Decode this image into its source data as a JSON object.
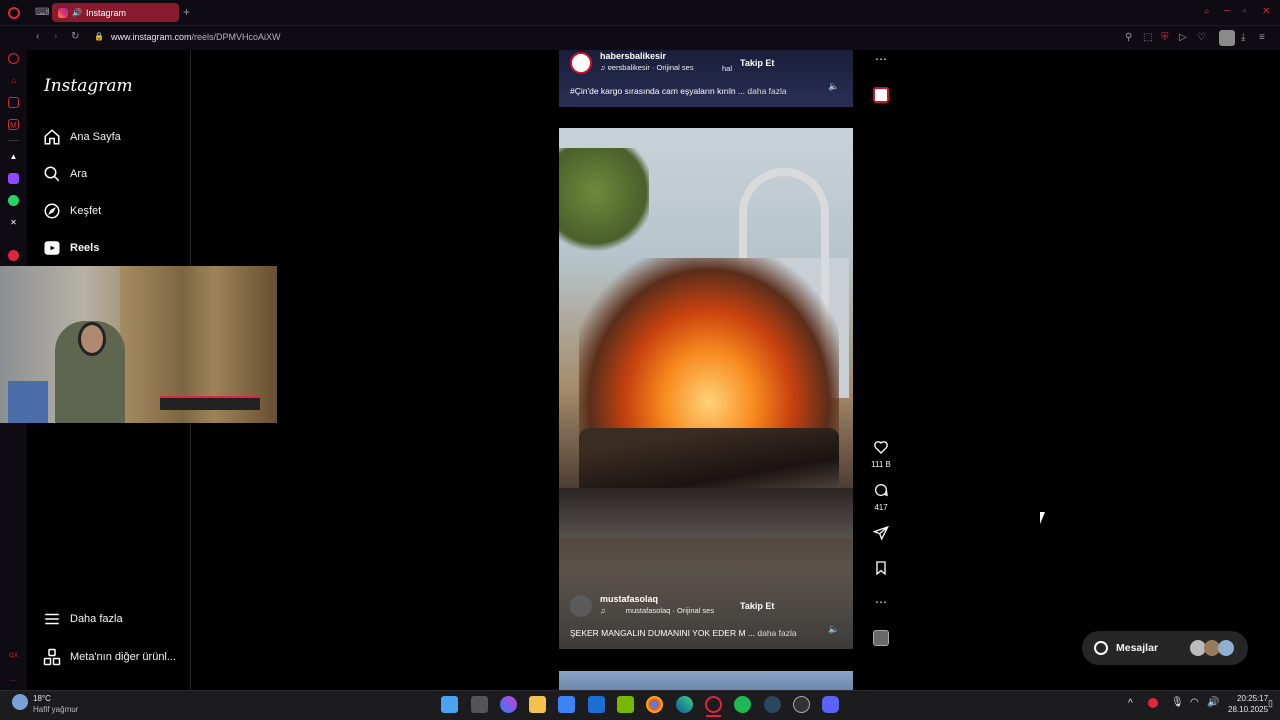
{
  "browser": {
    "tab_title": "Instagram",
    "url_host": "www.instagram.com",
    "url_path": "/reels/DPMVHcoAiXW"
  },
  "nav": {
    "logo": "Instagram",
    "items": [
      {
        "label": "Ana Sayfa",
        "icon": "home-icon"
      },
      {
        "label": "Ara",
        "icon": "search-icon"
      },
      {
        "label": "Keşfet",
        "icon": "compass-icon"
      },
      {
        "label": "Reels",
        "icon": "reels-icon"
      }
    ],
    "bottom": [
      {
        "label": "Daha fazla",
        "icon": "menu-icon"
      },
      {
        "label": "Meta'nın diğer ürünl...",
        "icon": "meta-products-icon"
      }
    ]
  },
  "reels": [
    {
      "username": "habersbalikesir",
      "audio": "ɐersbalikesir · Orijinal ses",
      "audio_extra": "hal",
      "follow": "Takip Et",
      "caption": "#Çin'de kargo sırasında cam eşyaların kırıln ...",
      "more": "daha fazla"
    },
    {
      "username": "mustafasolaq",
      "audio": "mustafasolaq · Orijinal ses",
      "follow": "Takip Et",
      "caption": "ŞEKER MANGALIN DUMANINI YOK EDER M ...",
      "more": "daha fazla",
      "likes": "111 B",
      "comments": "417"
    }
  ],
  "messages": {
    "label": "Mesajlar"
  },
  "taskbar": {
    "weather_temp": "18°C",
    "weather_desc": "Hafif yağmur",
    "time": "20:25:17",
    "date": "28.10.2025"
  },
  "colors": {
    "accent_tab": "#8a1b2f",
    "ig_bg": "#000000",
    "pill_bg": "#262626"
  }
}
